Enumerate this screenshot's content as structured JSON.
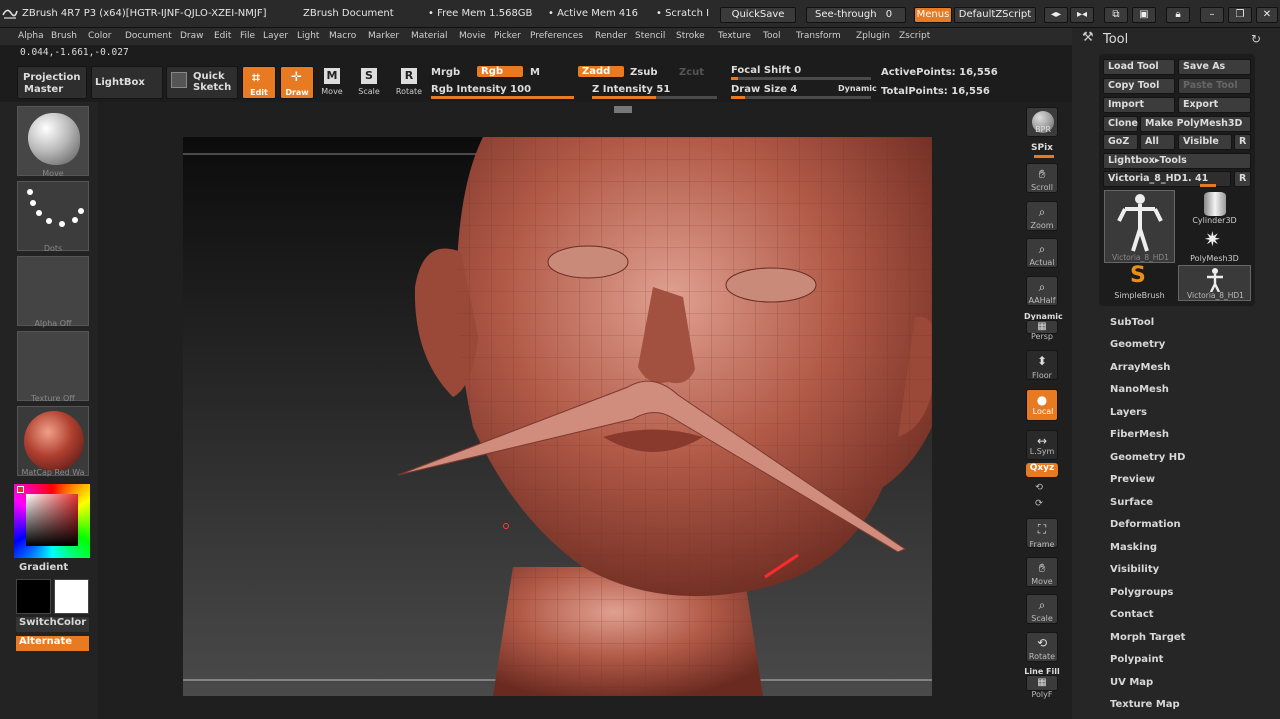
{
  "titlebar": {
    "app_title": "ZBrush 4R7 P3 (x64)[HGTR-IJNF-QJLO-XZEI-NMJF]",
    "document_title": "ZBrush Document",
    "free_mem": "• Free Mem 1.568GB",
    "active_mem": "• Active Mem 416",
    "scratch": "• Scratch I",
    "quicksave": "QuickSave",
    "see_through": "See-through",
    "see_through_value": "0",
    "menus": "Menus",
    "default_zscript": "DefaultZScript"
  },
  "menubar": [
    "Alpha",
    "Brush",
    "Color",
    "Document",
    "Draw",
    "Edit",
    "File",
    "Layer",
    "Light",
    "Macro",
    "Marker",
    "Material",
    "Movie",
    "Picker",
    "Preferences",
    "Render",
    "Stencil",
    "Stroke",
    "Texture",
    "Tool",
    "Transform",
    "Zplugin",
    "Zscript"
  ],
  "coords": "0.044,-1.661,-0.027",
  "shelf": {
    "projection_master_1": "Projection",
    "projection_master_2": "Master",
    "lightbox": "LightBox",
    "quick_sketch_1": "Quick",
    "quick_sketch_2": "Sketch",
    "edit": "Edit",
    "draw": "Draw",
    "move": "Move",
    "scale": "Scale",
    "rotate": "Rotate",
    "mrgb": "Mrgb",
    "rgb": "Rgb",
    "m": "M",
    "zadd": "Zadd",
    "zsub": "Zsub",
    "zcut": "Zcut",
    "rgb_intensity": "Rgb Intensity 100",
    "z_intensity": "Z Intensity 51",
    "focal_shift": "Focal Shift 0",
    "draw_size": "Draw Size 4",
    "dynamic": "Dynamic",
    "active_points": "ActivePoints: 16,556",
    "total_points": "TotalPoints: 16,556",
    "rgb_intensity_level": 1.0,
    "z_intensity_level": 0.51,
    "draw_size_level": 0.1,
    "focal_shift_level": 0.05
  },
  "left": {
    "brush_caption": "Move",
    "stroke_caption": "Dots",
    "alpha_caption": "Alpha Off",
    "texture_caption": "Texture Off",
    "material_caption": "MatCap Red Wa",
    "gradient": "Gradient",
    "switchcolor": "SwitchColor",
    "alternate": "Alternate"
  },
  "rightcol": {
    "bpr": "BPR",
    "spix": "SPix",
    "scroll": "Scroll",
    "zoom": "Zoom",
    "actual": "Actual",
    "aahalf": "AAHalf",
    "dynamic": "Dynamic",
    "persp": "Persp",
    "floor": "Floor",
    "local": "Local",
    "lsym": "L.Sym",
    "xyz": "Qxyz",
    "frame": "Frame",
    "move": "Move",
    "scale": "Scale",
    "rotate": "Rotate",
    "linefill": "Line Fill",
    "polyf": "PolyF"
  },
  "tool": {
    "title": "Tool",
    "load_tool": "Load Tool",
    "save_as": "Save As",
    "copy_tool": "Copy Tool",
    "paste_tool": "Paste Tool",
    "import": "Import",
    "export": "Export",
    "clone": "Clone",
    "make_polymesh": "Make PolyMesh3D",
    "goz": "GoZ",
    "all": "All",
    "visible": "Visible",
    "r": "R",
    "lightbox_tools": "Lightbox▸Tools",
    "current_tool": "Victoria_8_HD1. 41",
    "thumbs": [
      "Victoria_8_HD1",
      "Cylinder3D",
      "PolyMesh3D",
      "SimpleBrush",
      "Victoria_8_HD1"
    ],
    "sections": [
      "SubTool",
      "Geometry",
      "ArrayMesh",
      "NanoMesh",
      "Layers",
      "FiberMesh",
      "Geometry HD",
      "Preview",
      "Surface",
      "Deformation",
      "Masking",
      "Visibility",
      "Polygroups",
      "Contact",
      "Morph Target",
      "Polypaint",
      "UV Map",
      "Texture Map"
    ]
  },
  "colors": {
    "accent": "#e87a22",
    "panel": "#2e2e2e",
    "model": "#b45a48"
  }
}
